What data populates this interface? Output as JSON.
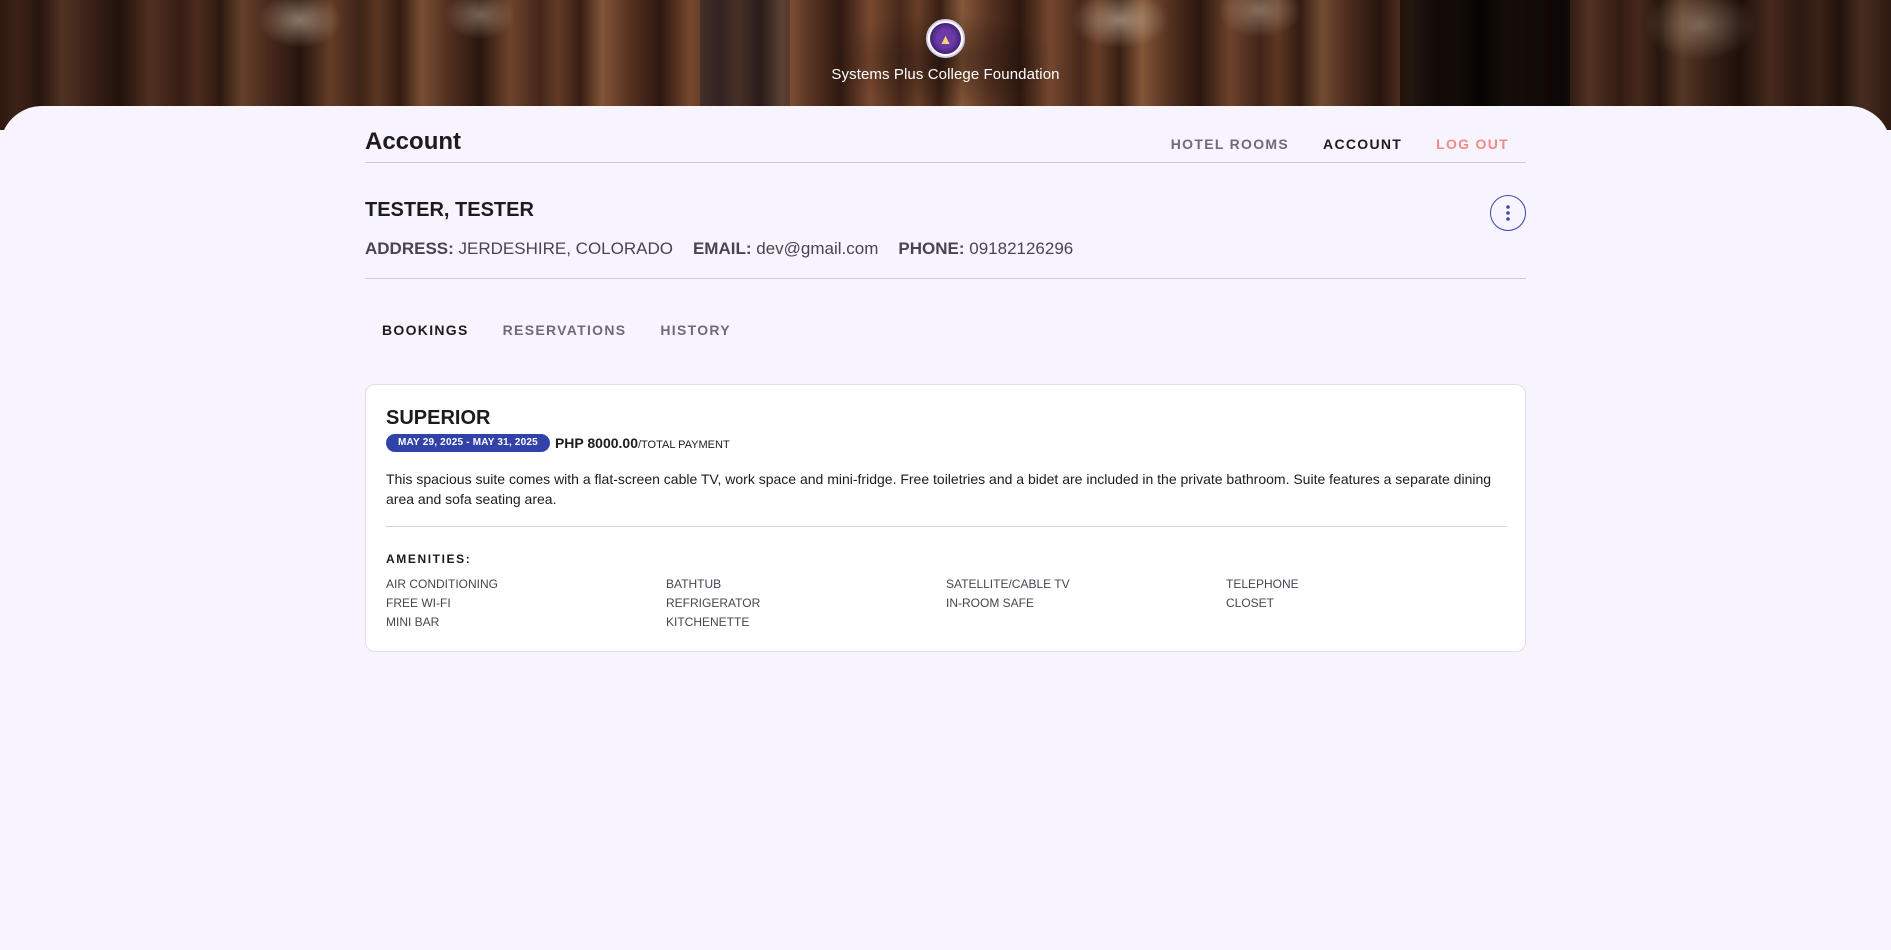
{
  "hero": {
    "org_name": "Systems Plus College Foundation",
    "logo_icon": "college-seal-icon"
  },
  "header": {
    "title": "Account",
    "nav": [
      {
        "label": "HOTEL ROOMS",
        "active": false
      },
      {
        "label": "ACCOUNT",
        "active": true
      },
      {
        "label": "LOG OUT",
        "color": "#f08a8a"
      }
    ]
  },
  "user": {
    "name": "TESTER, TESTER",
    "address_label": "ADDRESS:",
    "address": "JERDESHIRE, COLORADO",
    "email_label": "EMAIL:",
    "email": "dev@gmail.com",
    "phone_label": "PHONE:",
    "phone": "09182126296",
    "menu_icon": "more-vert-icon"
  },
  "tabs": [
    {
      "label": "BOOKINGS",
      "active": true
    },
    {
      "label": "RESERVATIONS",
      "active": false
    },
    {
      "label": "HISTORY",
      "active": false
    }
  ],
  "booking": {
    "room": "SUPERIOR",
    "dates": "MAY 29, 2025 - MAY 31, 2025",
    "price": "PHP 8000.00",
    "price_unit": "/TOTAL PAYMENT",
    "description": "This spacious suite comes with a flat-screen cable TV, work space and mini-fridge. Free toiletries and a bidet are included in the private bathroom. Suite features a separate dining area and sofa seating area.",
    "amenities_title": "AMENITIES:",
    "amenities": [
      "AIR CONDITIONING",
      "BATHTUB",
      "SATELLITE/CABLE TV",
      "TELEPHONE",
      "FREE WI-FI",
      "REFRIGERATOR",
      "IN-ROOM SAFE",
      "CLOSET",
      "MINI BAR",
      "KITCHENETTE"
    ]
  },
  "colors": {
    "accent": "#3142a8",
    "background": "#f7f4fd",
    "logout": "#f08a8a"
  }
}
